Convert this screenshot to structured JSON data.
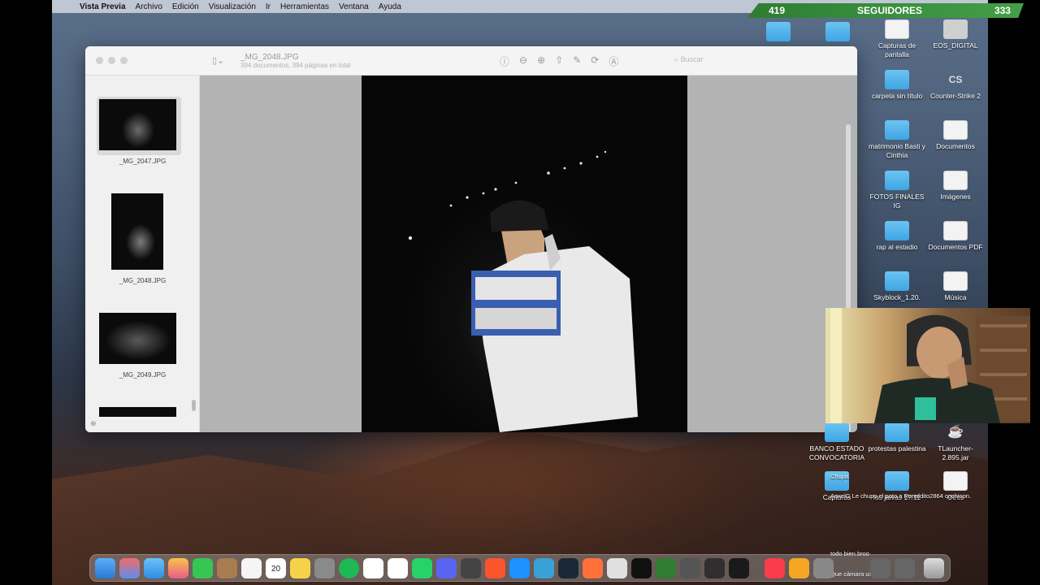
{
  "menubar": {
    "app_name": "Vista Previa",
    "items": [
      "Archivo",
      "Edición",
      "Visualización",
      "Ir",
      "Herramientas",
      "Ventana",
      "Ayuda"
    ]
  },
  "followers": {
    "left_count": "419",
    "label": "SEGUIDORES",
    "right_count": "333"
  },
  "preview": {
    "title": "_MG_2048.JPG",
    "subtitle": "394 documentos, 394 páginas en total",
    "search_placeholder": "Buscar",
    "thumbnails": [
      {
        "label": "_MG_2047.JPG",
        "selected": true
      },
      {
        "label": "_MG_2048.JPG",
        "selected": false
      },
      {
        "label": "_MG_2049.JPG",
        "selected": false
      }
    ]
  },
  "desktop_icons": [
    {
      "label": "",
      "kind": "folder"
    },
    {
      "label": "",
      "kind": "folder"
    },
    {
      "label": "Capturas de pantalla",
      "kind": "doc"
    },
    {
      "label": "EOS_DIGITAL",
      "kind": "doc"
    },
    {
      "label": "carpeta sin título",
      "kind": "folder"
    },
    {
      "label": "Counter-Strike 2",
      "kind": "app"
    },
    {
      "label": "matrimonio Basti y Cinthia",
      "kind": "folder"
    },
    {
      "label": "Documentos",
      "kind": "doc"
    },
    {
      "label": "FOTOS FINALES IG",
      "kind": "folder"
    },
    {
      "label": "Imágenes",
      "kind": "doc"
    },
    {
      "label": "rap al estadio",
      "kind": "folder"
    },
    {
      "label": "Documentos PDF",
      "kind": "doc"
    },
    {
      "label": "Skyblock_1.20.",
      "kind": "folder"
    },
    {
      "label": "Música",
      "kind": "doc"
    },
    {
      "label": "BANCO ESTADO CONVOCATORIA",
      "kind": "folder"
    },
    {
      "label": "protestas palestina",
      "kind": "folder"
    },
    {
      "label": "TLauncher-2.895.jar",
      "kind": "doc"
    },
    {
      "label": "Capturas",
      "kind": "folder"
    },
    {
      "label": "los jaivas 17/11",
      "kind": "folder"
    },
    {
      "label": "Otros",
      "kind": "doc"
    }
  ],
  "chat": {
    "line1": "Chupa",
    "line2": "AnxelG Le chupo el poto a Ronaldito2864 cochinon.",
    "line3": "todo bien broo",
    "line4": "Que cámara usas"
  },
  "dock": {
    "calendar_day": "20",
    "calendar_month": "NOV"
  }
}
